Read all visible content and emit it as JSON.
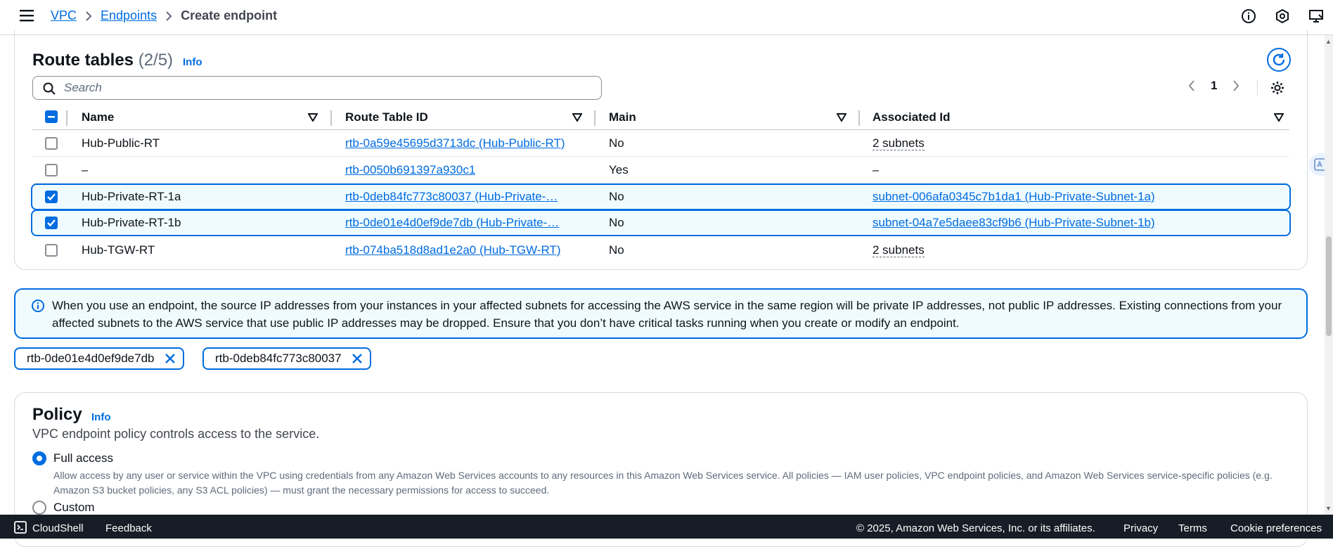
{
  "breadcrumb": {
    "items": [
      "VPC",
      "Endpoints"
    ],
    "current": "Create endpoint"
  },
  "route_tables": {
    "title": "Route tables",
    "count": "(2/5)",
    "info": "Info",
    "search_placeholder": "Search",
    "page": "1",
    "columns": [
      "Name",
      "Route Table ID",
      "Main",
      "Associated Id"
    ],
    "rows": [
      {
        "name": "Hub-Public-RT",
        "id": "rtb-0a59e45695d3713dc (Hub-Public-RT)",
        "main": "No",
        "assoc": "2 subnets",
        "selected": false
      },
      {
        "name": "–",
        "id": "rtb-0050b691397a930c1",
        "main": "Yes",
        "assoc": "–",
        "selected": false
      },
      {
        "name": "Hub-Private-RT-1a",
        "id": "rtb-0deb84fc773c80037 (Hub-Private-…",
        "main": "No",
        "assoc": "subnet-006afa0345c7b1da1 (Hub-Private-Subnet-1a)",
        "selected": true
      },
      {
        "name": "Hub-Private-RT-1b",
        "id": "rtb-0de01e4d0ef9de7db (Hub-Private-…",
        "main": "No",
        "assoc": "subnet-04a7e5daee83cf9b6 (Hub-Private-Subnet-1b)",
        "selected": true
      },
      {
        "name": "Hub-TGW-RT",
        "id": "rtb-074ba518d8ad1e2a0 (Hub-TGW-RT)",
        "main": "No",
        "assoc": "2 subnets",
        "selected": false
      }
    ]
  },
  "alert": {
    "text": "When you use an endpoint, the source IP addresses from your instances in your affected subnets for accessing the AWS service in the same region will be private IP addresses, not public IP addresses. Existing connections from your affected subnets to the AWS service that use public IP addresses may be dropped. Ensure that you don’t have critical tasks running when you create or modify an endpoint."
  },
  "tokens": [
    "rtb-0de01e4d0ef9de7db",
    "rtb-0deb84fc773c80037"
  ],
  "policy": {
    "title": "Policy",
    "info": "Info",
    "description": "VPC endpoint policy controls access to the service.",
    "options": [
      {
        "label": "Full access",
        "desc": "Allow access by any user or service within the VPC using credentials from any Amazon Web Services accounts to any resources in this Amazon Web Services service. All policies — IAM user policies, VPC endpoint policies, and Amazon Web Services service-specific policies (e.g. Amazon S3 bucket policies, any S3 ACL policies) — must grant the necessary permissions for access to succeed.",
        "selected": true
      },
      {
        "label": "Custom",
        "selected": false
      }
    ]
  },
  "footer": {
    "cloudshell": "CloudShell",
    "feedback": "Feedback",
    "copyright": "© 2025, Amazon Web Services, Inc. or its affiliates.",
    "privacy": "Privacy",
    "terms": "Terms",
    "cookies": "Cookie preferences"
  },
  "colors": {
    "accent": "#006ce0",
    "footer_bg": "#161d26",
    "selected_bg": "#f0fbff"
  }
}
